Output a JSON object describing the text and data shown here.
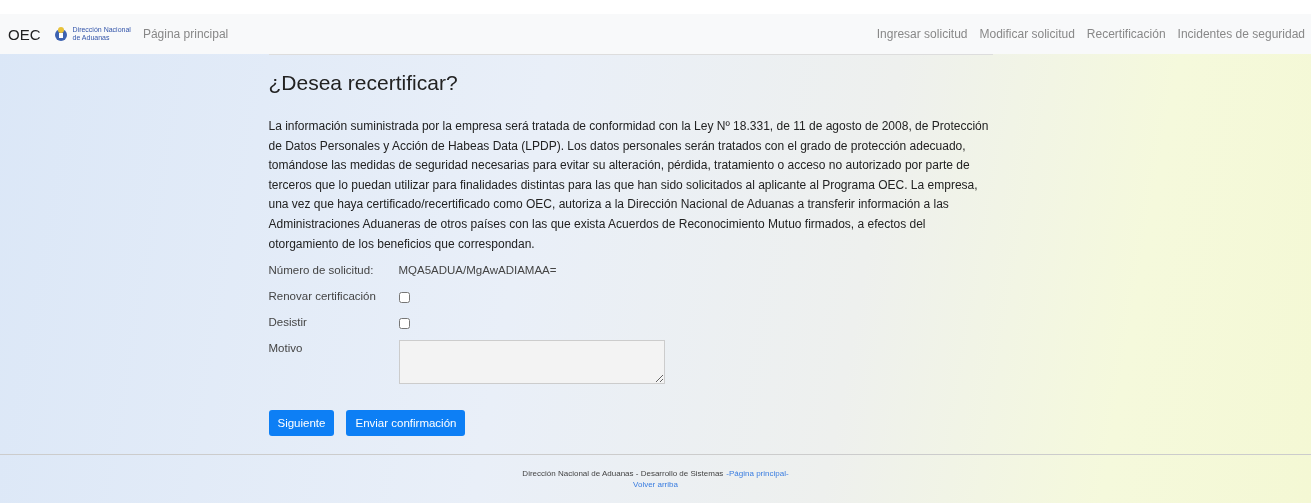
{
  "navbar": {
    "brand": "OEC",
    "logo_text": [
      "Dirección Nacional",
      "de Aduanas"
    ],
    "home": "Página principal",
    "links": [
      "Ingresar solicitud",
      "Modificar solicitud",
      "Recertificación",
      "Incidentes de seguridad"
    ]
  },
  "title": "¿Desea recertificar?",
  "notice": "La información suministrada por la empresa será tratada de conformidad con la Ley Nº 18.331, de 11 de agosto de 2008, de Protección de Datos Personales y Acción de Habeas Data (LPDP). Los datos personales serán tratados con el grado de protección adecuado, tomándose las medidas de seguridad necesarias para evitar su alteración, pérdida, tratamiento o acceso no autorizado por parte de terceros que lo puedan utilizar para finalidades distintas para las que han sido solicitados al aplicante al Programa OEC. La empresa, una vez que haya certificado/recertificado como OEC, autoriza a la Dirección Nacional de Aduanas a transferir información a las Administraciones Aduaneras de otros países con las que exista Acuerdos de Reconocimiento Mutuo firmados, a efectos del otorgamiento de los beneficios que correspondan.",
  "fields": [
    {
      "kind": "text",
      "label": "Número de solicitud:",
      "value": "MQA5ADUA/MgAwADIAMAA="
    },
    {
      "kind": "checkbox",
      "label": "Renovar certificación",
      "checked": false
    },
    {
      "kind": "checkbox",
      "label": "Desistir",
      "checked": false
    },
    {
      "kind": "textarea",
      "label": "Motivo"
    }
  ],
  "buttons": [
    "Siguiente",
    "Enviar confirmación"
  ],
  "footer": {
    "text": "Dirección Nacional de Aduanas - Desarrollo de Sistemas",
    "link": "-Página principal-",
    "back": "Volver arriba"
  }
}
